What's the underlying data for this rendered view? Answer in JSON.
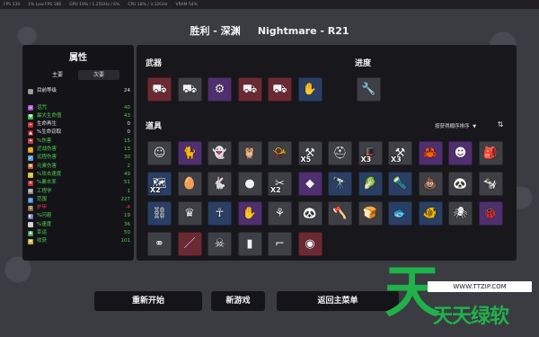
{
  "perf_bar": [
    "FPS  330",
    "1% Low FPS  186",
    "GPU  19% / 1.25GHz / 6%",
    "CPU  18% / 3.12GHz",
    "VRAM  54%"
  ],
  "run_title": "胜利 - 深渊     Nightmare - R21",
  "stats": {
    "title": "属性",
    "tab_primary": "主要",
    "tab_secondary": "次要",
    "rows": [
      {
        "name": "目前等级",
        "value": "24",
        "color": "#8a8a8a",
        "icon": "level-icon",
        "glyph": "○"
      },
      {
        "name": "",
        "value": "",
        "color": "transparent",
        "icon": "",
        "glyph": ""
      },
      {
        "name": "诅咒",
        "value": "40",
        "color": "#b04ad0",
        "icon": "curse-icon",
        "glyph": "☠"
      },
      {
        "name": "最大生命值",
        "value": "43",
        "color": "#3bbf3b",
        "icon": "heart-icon",
        "glyph": "♥"
      },
      {
        "name": "生命再生",
        "value": "0",
        "color": "#c03030",
        "icon": "regen-icon",
        "glyph": "+"
      },
      {
        "name": "%生命窃取",
        "value": "0",
        "color": "#a02020",
        "icon": "lifesteal-icon",
        "glyph": "▲"
      },
      {
        "name": "%伤害",
        "value": "15",
        "color": "#c04040",
        "icon": "damage-icon",
        "glyph": "✦"
      },
      {
        "name": "近战伤害",
        "value": "13",
        "color": "#d08a2a",
        "icon": "melee-icon",
        "glyph": "✊"
      },
      {
        "name": "远程伤害",
        "value": "30",
        "color": "#5aa0d0",
        "icon": "ranged-icon",
        "glyph": "➶"
      },
      {
        "name": "元素伤害",
        "value": "2",
        "color": "#d05a2a",
        "icon": "elemental-icon",
        "glyph": "✹"
      },
      {
        "name": "%攻击速度",
        "value": "49",
        "color": "#d0c03a",
        "icon": "attack-speed-icon",
        "glyph": "»"
      },
      {
        "name": "%暴击率",
        "value": "51",
        "color": "#c03030",
        "icon": "crit-icon",
        "glyph": "✕"
      },
      {
        "name": "工程学",
        "value": "1",
        "color": "#8a8a8a",
        "icon": "engineering-icon",
        "glyph": "⚙"
      },
      {
        "name": "范围",
        "value": "227",
        "color": "#3a7ad0",
        "icon": "range-icon",
        "glyph": "◎"
      },
      {
        "name": "护甲",
        "value": "-4",
        "color": "#8a6a3a",
        "icon": "armor-icon",
        "glyph": "⛨"
      },
      {
        "name": "%闪避",
        "value": "19",
        "color": "#6a6aaa",
        "icon": "dodge-icon",
        "glyph": "◐"
      },
      {
        "name": "%速度",
        "value": "36",
        "color": "#cfcfcf",
        "icon": "speed-icon",
        "glyph": "›"
      },
      {
        "name": "幸运",
        "value": "50",
        "color": "#3aa05a",
        "icon": "luck-icon",
        "glyph": "♣"
      },
      {
        "name": "收获",
        "value": "101",
        "color": "#d0b03a",
        "icon": "harvest-icon",
        "glyph": "♦"
      }
    ],
    "value_colors": {
      "default": "#e8e8e8",
      "positive": "#4fd04f",
      "negative": "#e04040"
    }
  },
  "weapons": {
    "label": "武器",
    "slots": [
      {
        "icon": "minigun-icon",
        "glyph": "⛟",
        "tier": "t4"
      },
      {
        "icon": "minigun-icon",
        "glyph": "⛟",
        "tier": "t1"
      },
      {
        "icon": "obliterator-icon",
        "glyph": "⚙",
        "tier": "t3"
      },
      {
        "icon": "minigun-icon",
        "glyph": "⛟",
        "tier": "t4"
      },
      {
        "icon": "minigun-icon",
        "glyph": "⛟",
        "tier": "t4"
      },
      {
        "icon": "hand-icon",
        "glyph": "✋",
        "tier": "t2"
      }
    ]
  },
  "progress": {
    "label": "进度",
    "slots": [
      {
        "icon": "wrench-icon",
        "glyph": "🔧",
        "tier": "t1"
      }
    ]
  },
  "items": {
    "label": "道具",
    "sort_label": "按获得顺序排序",
    "sort_dropdown_icon": "▼",
    "sort_direction_icon": "⇅",
    "rows": [
      [
        {
          "icon": "bandaged-head-icon",
          "glyph": "☺",
          "tier": "t1",
          "qty": ""
        },
        {
          "icon": "cat-icon",
          "glyph": "🐈",
          "tier": "t3",
          "qty": ""
        },
        {
          "icon": "ghost-icon",
          "glyph": "👻",
          "tier": "t1",
          "qty": ""
        },
        {
          "icon": "owl-icon",
          "glyph": "🦉",
          "tier": "t1",
          "qty": ""
        },
        {
          "icon": "whistle-icon",
          "glyph": "📯",
          "tier": "t1",
          "qty": ""
        },
        {
          "icon": "scythe-icon",
          "glyph": "⚒",
          "tier": "t1",
          "qty": "X5"
        },
        {
          "icon": "helmet-icon",
          "glyph": "⛑",
          "tier": "t1",
          "qty": ""
        },
        {
          "icon": "red-hat-icon",
          "glyph": "🎩",
          "tier": "t1",
          "qty": "X3"
        },
        {
          "icon": "hammer-icon",
          "glyph": "⚒",
          "tier": "t1",
          "qty": "X3"
        },
        {
          "icon": "crab-icon",
          "glyph": "🦀",
          "tier": "t3",
          "qty": ""
        },
        {
          "icon": "demon-face-icon",
          "glyph": "☻",
          "tier": "t3",
          "qty": ""
        },
        {
          "icon": "bag-icon",
          "glyph": "🎒",
          "tier": "t1",
          "qty": ""
        }
      ],
      [
        {
          "icon": "map-icon",
          "glyph": "🗺",
          "tier": "t2",
          "qty": "X2"
        },
        {
          "icon": "egg-icon",
          "glyph": "🥚",
          "tier": "t1",
          "qty": ""
        },
        {
          "icon": "bunny-icon",
          "glyph": "🐇",
          "tier": "t1",
          "qty": ""
        },
        {
          "icon": "snowball-icon",
          "glyph": "●",
          "tier": "t1",
          "qty": ""
        },
        {
          "icon": "claw-icon",
          "glyph": "✂",
          "tier": "t1",
          "qty": "X2"
        },
        {
          "icon": "crystal-icon",
          "glyph": "◆",
          "tier": "t3",
          "qty": ""
        },
        {
          "icon": "telescope-icon",
          "glyph": "🔭",
          "tier": "t2",
          "qty": ""
        },
        {
          "icon": "cabbage-icon",
          "glyph": "🥬",
          "tier": "t2",
          "qty": ""
        },
        {
          "icon": "flashlight-icon",
          "glyph": "🔦",
          "tier": "t2",
          "qty": ""
        },
        {
          "icon": "poop-icon",
          "glyph": "💩",
          "tier": "t1",
          "qty": ""
        },
        {
          "icon": "panda-icon",
          "glyph": "🐼",
          "tier": "t1",
          "qty": ""
        },
        {
          "icon": "cow-icon",
          "glyph": "🐄",
          "tier": "t1",
          "qty": ""
        }
      ],
      [
        {
          "icon": "binoculars-icon",
          "glyph": "⛓",
          "tier": "t2",
          "qty": ""
        },
        {
          "icon": "crown-icon",
          "glyph": "♛",
          "tier": "t1",
          "qty": ""
        },
        {
          "icon": "angel-icon",
          "glyph": "☥",
          "tier": "t2",
          "qty": ""
        },
        {
          "icon": "purple-claw-icon",
          "glyph": "✋",
          "tier": "t3",
          "qty": ""
        },
        {
          "icon": "branch-icon",
          "glyph": "⚘",
          "tier": "t1",
          "qty": ""
        },
        {
          "icon": "panda-face-icon",
          "glyph": "🐼",
          "tier": "t1",
          "qty": ""
        },
        {
          "icon": "axe-icon",
          "glyph": "🪓",
          "tier": "t1",
          "qty": ""
        },
        {
          "icon": "bread-icon",
          "glyph": "🍞",
          "tier": "t1",
          "qty": ""
        },
        {
          "icon": "fish-bowl-icon",
          "glyph": "🐟",
          "tier": "t2",
          "qty": ""
        },
        {
          "icon": "goldfish-icon",
          "glyph": "🐠",
          "tier": "t2",
          "qty": ""
        },
        {
          "icon": "spider-icon",
          "glyph": "🕷",
          "tier": "t1",
          "qty": ""
        },
        {
          "icon": "critter-icon",
          "glyph": "🐞",
          "tier": "t3",
          "qty": ""
        }
      ],
      [
        {
          "icon": "goggles-icon",
          "glyph": "⚭",
          "tier": "t1",
          "qty": ""
        },
        {
          "icon": "needle-icon",
          "glyph": "／",
          "tier": "t4",
          "qty": ""
        },
        {
          "icon": "skull-mask-icon",
          "glyph": "☠",
          "tier": "t1",
          "qty": ""
        },
        {
          "icon": "bullet-icon",
          "glyph": "▮",
          "tier": "t1",
          "qty": ""
        },
        {
          "icon": "sunglasses-icon",
          "glyph": "⌐",
          "tier": "t1",
          "qty": ""
        },
        {
          "icon": "ring-icon",
          "glyph": "◉",
          "tier": "t4",
          "qty": ""
        }
      ]
    ]
  },
  "buttons": {
    "restart": "重新开始",
    "new_game": "新游戏",
    "main_menu": "返回主菜单"
  },
  "watermark": {
    "big_char": "天",
    "url": "WWW.TTZIP.COM",
    "brand": "天天绿软"
  }
}
